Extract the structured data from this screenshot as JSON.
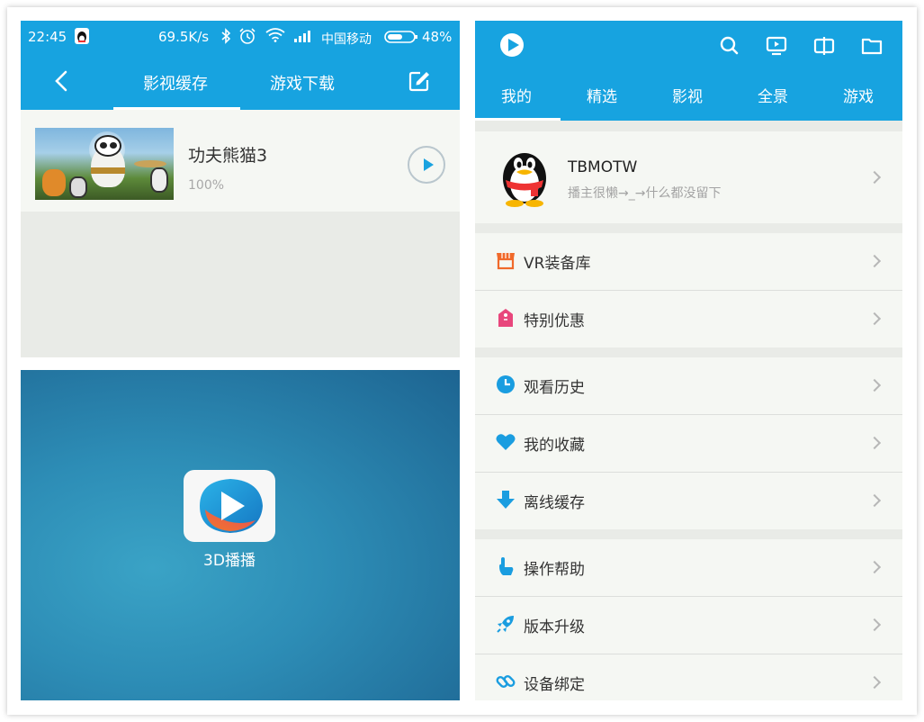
{
  "colors": {
    "brand_blue": "#17a3e0",
    "row_bg": "#f5f7f3",
    "section_gap": "#e9ebe7"
  },
  "status_bar": {
    "time": "22:45",
    "speed": "69.5K/s",
    "carrier": "中国移动",
    "battery": "48%"
  },
  "download_screen": {
    "tabs": [
      {
        "label": "影视缓存",
        "active": true
      },
      {
        "label": "游戏下载",
        "active": false
      }
    ],
    "item": {
      "title": "功夫熊猫3",
      "progress": "100%"
    }
  },
  "splash_screen": {
    "app_name": "3D播播"
  },
  "mine_screen": {
    "top_icons": [
      "search-icon",
      "screen-icon",
      "vr-split-icon",
      "folder-icon"
    ],
    "tabs": [
      {
        "label": "我的",
        "active": true
      },
      {
        "label": "精选",
        "active": false
      },
      {
        "label": "影视",
        "active": false
      },
      {
        "label": "全景",
        "active": false
      },
      {
        "label": "游戏",
        "active": false
      }
    ],
    "profile": {
      "username": "TBMOTW",
      "signature": "播主很懒→_→什么都没留下"
    },
    "menu_groups": [
      [
        {
          "label": "VR装备库",
          "icon": "store-icon",
          "color": "#f0692a"
        },
        {
          "label": "特别优惠",
          "icon": "tag-icon",
          "color": "#e8467c"
        }
      ],
      [
        {
          "label": "观看历史",
          "icon": "clock-icon",
          "color": "#1a9de0"
        },
        {
          "label": "我的收藏",
          "icon": "heart-icon",
          "color": "#1a9de0"
        },
        {
          "label": "离线缓存",
          "icon": "download-icon",
          "color": "#1a9de0"
        }
      ],
      [
        {
          "label": "操作帮助",
          "icon": "hand-icon",
          "color": "#1a9de0"
        },
        {
          "label": "版本升级",
          "icon": "rocket-icon",
          "color": "#1a9de0"
        },
        {
          "label": "设备绑定",
          "icon": "link-icon",
          "color": "#1a9de0"
        }
      ]
    ]
  }
}
